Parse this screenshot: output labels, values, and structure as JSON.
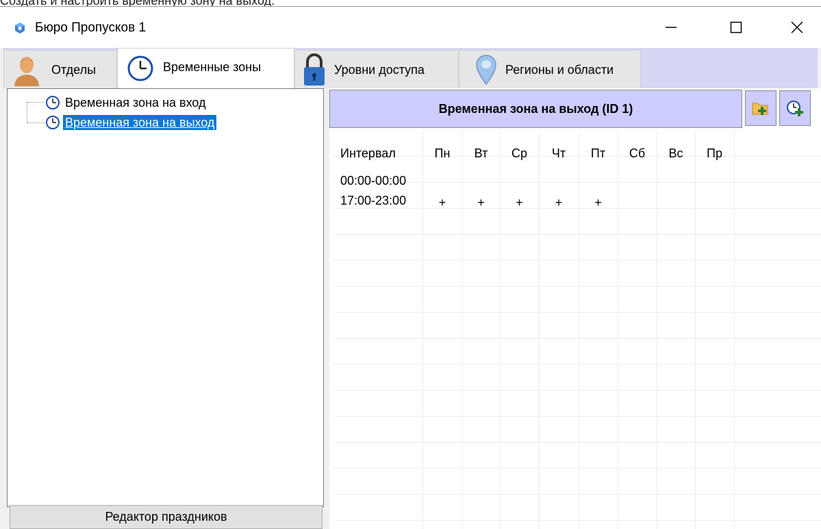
{
  "caption": "Создать и настроить временную зону на выход:",
  "window": {
    "title": "Бюро Пропусков 1",
    "controls": {
      "minimize": "—",
      "maximize": "☐",
      "close": "✕"
    }
  },
  "tabs": [
    {
      "label": "Отделы",
      "icon": "person-icon",
      "active": false
    },
    {
      "label": "Временные зоны",
      "icon": "clock-icon",
      "active": true
    },
    {
      "label": "Уровни доступа",
      "icon": "lock-icon",
      "active": false
    },
    {
      "label": "Регионы и области",
      "icon": "map-pin-icon",
      "active": false
    }
  ],
  "tree": {
    "items": [
      {
        "label": "Временная зона на вход",
        "selected": false
      },
      {
        "label": "Временная зона на выход",
        "selected": true
      }
    ]
  },
  "holiday_editor_label": "Редактор праздников",
  "zone": {
    "title": "Временная зона на выход (ID 1)",
    "tools": [
      "folder-add-icon",
      "clock-add-icon"
    ]
  },
  "schedule": {
    "columns": [
      "Интервал",
      "Пн",
      "Вт",
      "Ср",
      "Чт",
      "Пт",
      "Сб",
      "Вс",
      "Пр"
    ],
    "rows": [
      {
        "interval": "00:00-00:00",
        "days": [
          "",
          "",
          "",
          "",
          "",
          "",
          "",
          ""
        ]
      },
      {
        "interval": "17:00-23:00",
        "days": [
          "+",
          "+",
          "+",
          "+",
          "+",
          "",
          "",
          ""
        ]
      }
    ]
  },
  "colors": {
    "tabstrip_bg": "#d6d6f5",
    "header_bg": "#ccccff",
    "selection": "#0078d7"
  }
}
